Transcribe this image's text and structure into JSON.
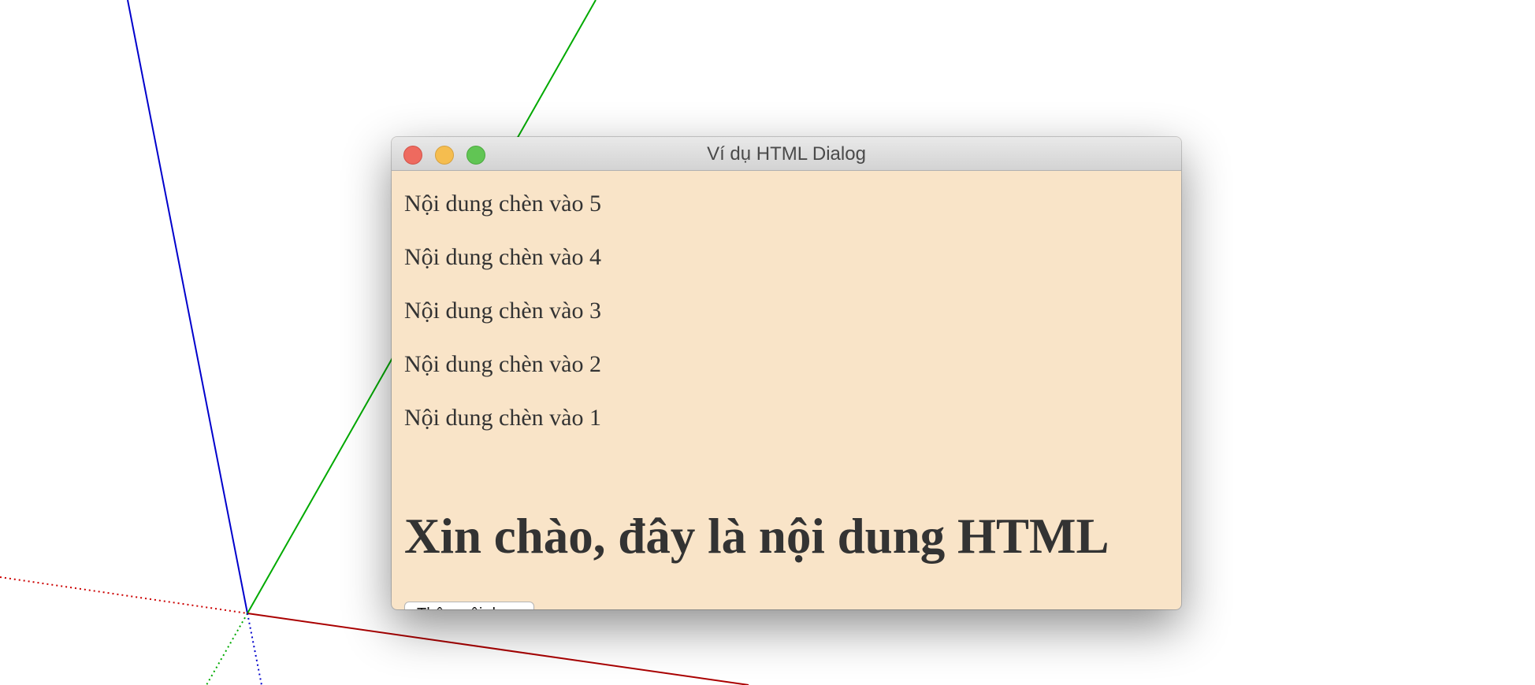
{
  "window": {
    "title": "Ví dụ HTML Dialog"
  },
  "content": {
    "paragraphs": [
      "Nội dung chèn vào 5",
      "Nội dung chèn vào 4",
      "Nội dung chèn vào 3",
      "Nội dung chèn vào 2",
      "Nội dung chèn vào 1"
    ],
    "heading": "Xin chào, đây là nội dung HTML",
    "add_button_label": "Thêm nội dung"
  },
  "colors": {
    "dialog_background": "#f9e4c8",
    "axis_blue": "#0000cc",
    "axis_green": "#00aa00",
    "axis_red": "#aa0000"
  }
}
